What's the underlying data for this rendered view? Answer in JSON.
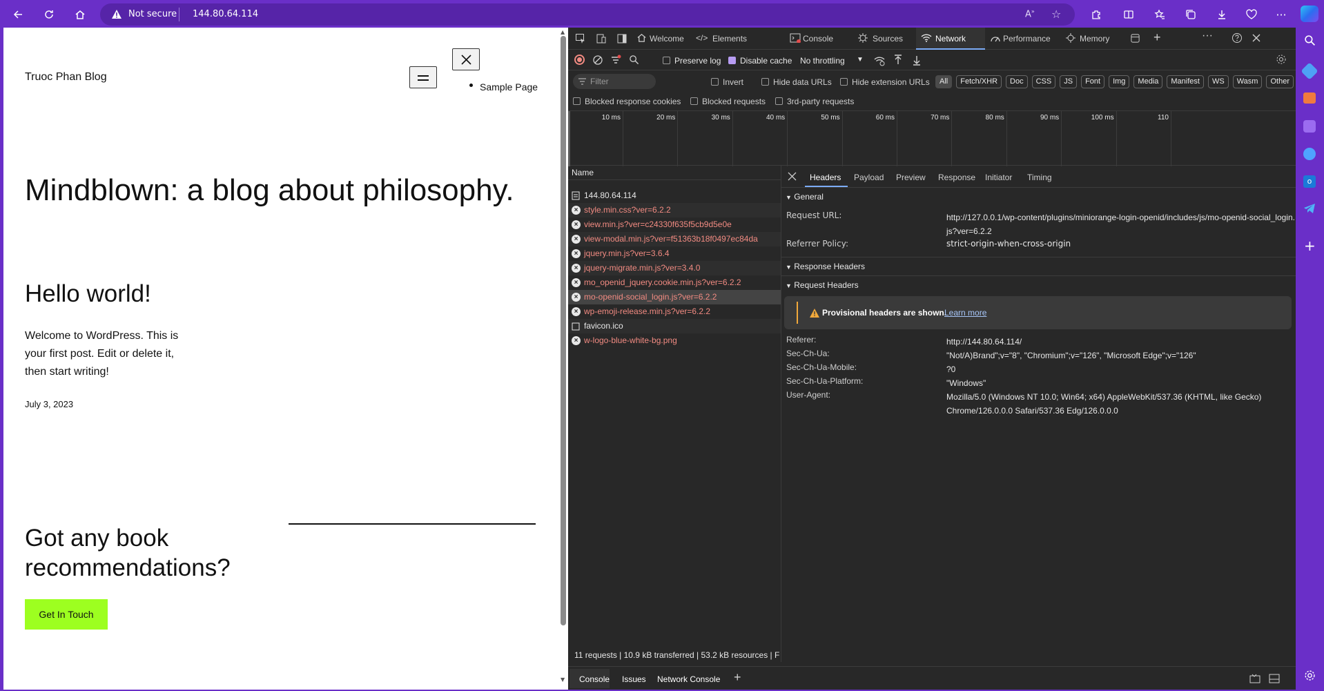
{
  "browser": {
    "security_label": "Not secure",
    "url": "144.80.64.114"
  },
  "blog": {
    "site_title": "Truoc Phan Blog",
    "nav_item": "Sample Page",
    "hero_title": "Mindblown: a blog about philosophy.",
    "post_title": "Hello world!",
    "post_excerpt": "Welcome to WordPress. This is your first post. Edit or delete it, then start writing!",
    "post_date": "July 3, 2023",
    "cta_title": "Got any book recommendations?",
    "cta_button": "Get In Touch",
    "cta_color": "#9dff20"
  },
  "devtools": {
    "tabs": [
      "Welcome",
      "Elements",
      "Console",
      "Sources",
      "Network",
      "Performance",
      "Memory"
    ],
    "active_tab": "Network",
    "toolbar": {
      "preserve_log": "Preserve log",
      "disable_cache": "Disable cache",
      "throttling": "No throttling"
    },
    "filter": {
      "placeholder": "Filter",
      "invert": "Invert",
      "hide_data_urls": "Hide data URLs",
      "hide_extension_urls": "Hide extension URLs",
      "types": [
        "All",
        "Fetch/XHR",
        "Doc",
        "CSS",
        "JS",
        "Font",
        "Img",
        "Media",
        "Manifest",
        "WS",
        "Wasm",
        "Other"
      ],
      "blocked_cookies": "Blocked response cookies",
      "blocked_requests": "Blocked requests",
      "third_party": "3rd-party requests"
    },
    "timeline_ticks": [
      "10 ms",
      "20 ms",
      "30 ms",
      "40 ms",
      "50 ms",
      "60 ms",
      "70 ms",
      "80 ms",
      "90 ms",
      "100 ms",
      "110"
    ],
    "name_header": "Name",
    "requests": [
      {
        "name": "144.80.64.114",
        "status": "doc"
      },
      {
        "name": "style.min.css?ver=6.2.2",
        "status": "error"
      },
      {
        "name": "view.min.js?ver=c24330f635f5cb9d5e0e",
        "status": "error"
      },
      {
        "name": "view-modal.min.js?ver=f51363b18f0497ec84da",
        "status": "error"
      },
      {
        "name": "jquery.min.js?ver=3.6.4",
        "status": "error"
      },
      {
        "name": "jquery-migrate.min.js?ver=3.4.0",
        "status": "error"
      },
      {
        "name": "mo_openid_jquery.cookie.min.js?ver=6.2.2",
        "status": "error"
      },
      {
        "name": "mo-openid-social_login.js?ver=6.2.2",
        "status": "error"
      },
      {
        "name": "wp-emoji-release.min.js?ver=6.2.2",
        "status": "error"
      },
      {
        "name": "favicon.ico",
        "status": "ok"
      },
      {
        "name": "w-logo-blue-white-bg.png",
        "status": "error"
      }
    ],
    "summary": {
      "requests": "11 requests",
      "transferred": "10.9 kB transferred",
      "resources": "53.2 kB resources",
      "finish": "Finis"
    },
    "detail_tabs": [
      "Headers",
      "Payload",
      "Preview",
      "Response",
      "Initiator",
      "Timing"
    ],
    "general": {
      "title": "General",
      "request_url_key": "Request URL:",
      "request_url_value": "http://127.0.0.1/wp-content/plugins/miniorange-login-openid/includes/js/mo-openid-social_login.js?ver=6.2.2",
      "referrer_policy_key": "Referrer Policy:",
      "referrer_policy_value": "strict-origin-when-cross-origin"
    },
    "response_headers_title": "Response Headers",
    "request_headers": {
      "title": "Request Headers",
      "warning": "Provisional headers are shown.",
      "learn_more": "Learn more",
      "items": [
        {
          "key": "Referer:",
          "value": "http://144.80.64.114/"
        },
        {
          "key": "Sec-Ch-Ua:",
          "value": "\"Not/A)Brand\";v=\"8\", \"Chromium\";v=\"126\", \"Microsoft Edge\";v=\"126\""
        },
        {
          "key": "Sec-Ch-Ua-Mobile:",
          "value": "?0"
        },
        {
          "key": "Sec-Ch-Ua-Platform:",
          "value": "\"Windows\""
        },
        {
          "key": "User-Agent:",
          "value": "Mozilla/5.0 (Windows NT 10.0; Win64; x64) AppleWebKit/537.36 (KHTML, like Gecko) Chrome/126.0.0.0 Safari/537.36 Edg/126.0.0.0"
        }
      ]
    },
    "drawer_tabs": [
      "Console",
      "Issues",
      "Network Console"
    ]
  },
  "colors": {
    "frame": "#6a2fc8",
    "devtools_bg": "#282828",
    "error": "#f28b82",
    "active_tab_line": "#7cacf8"
  }
}
